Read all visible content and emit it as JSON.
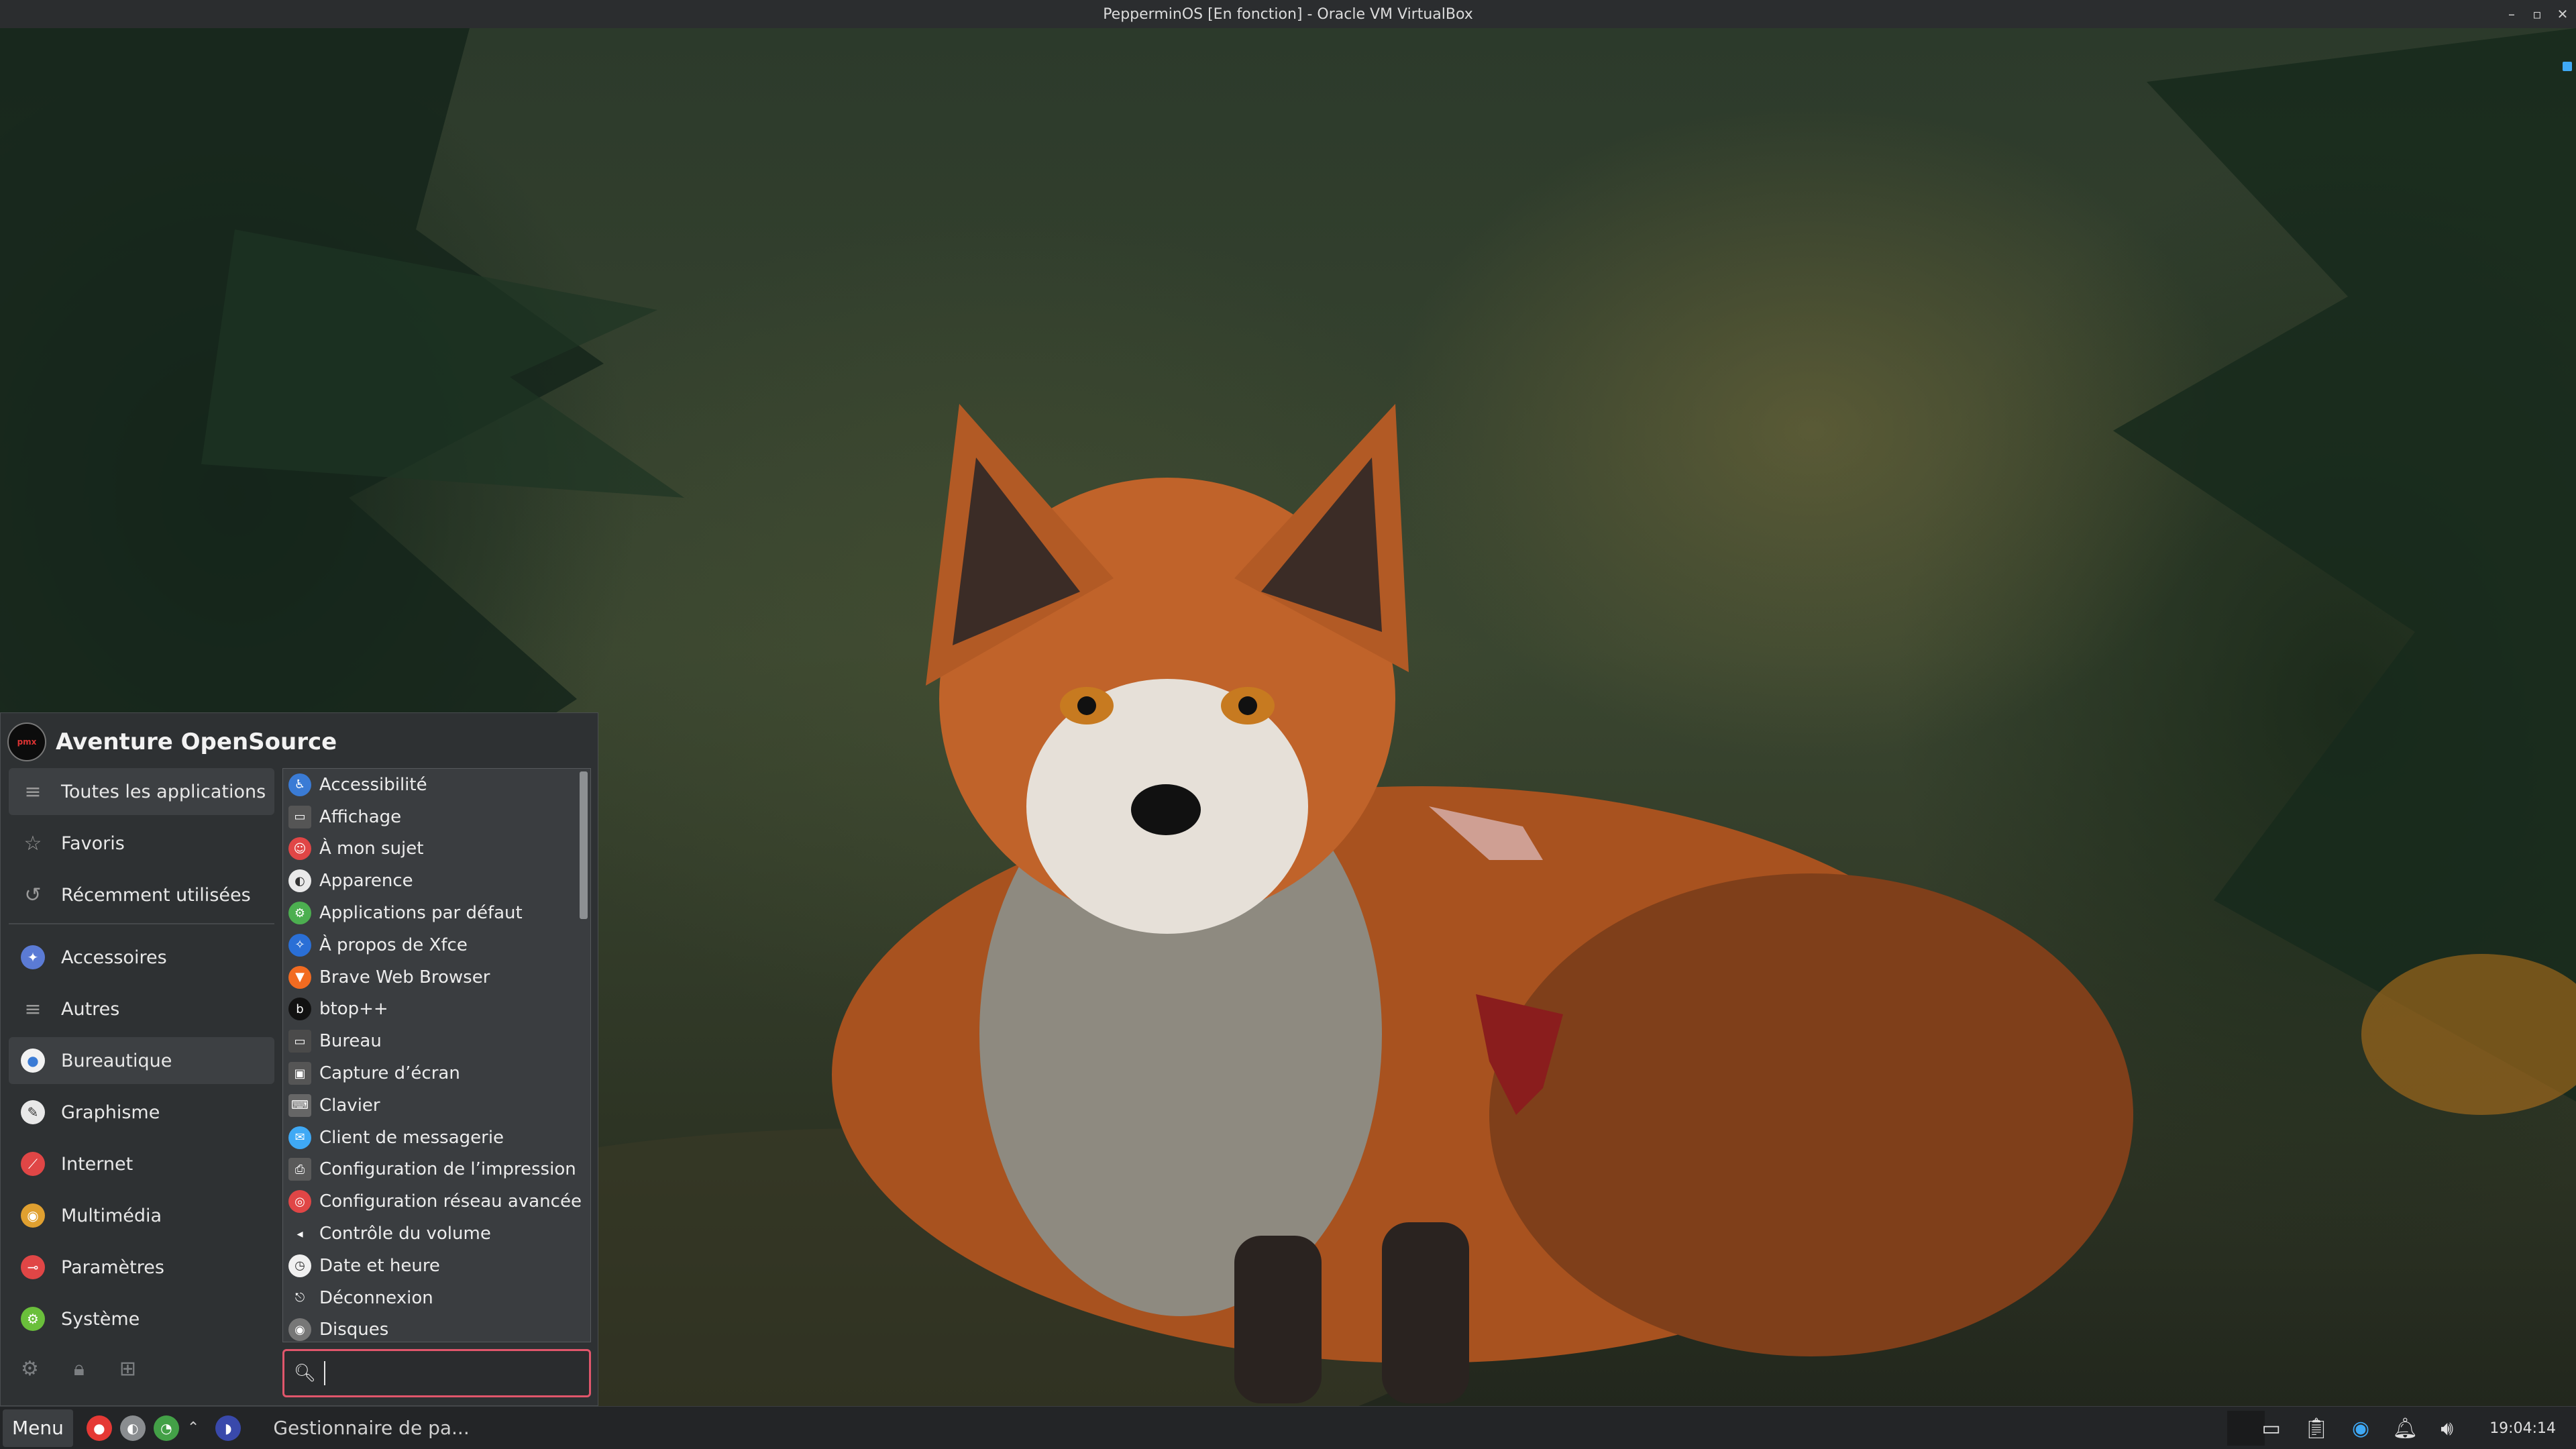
{
  "window": {
    "title": "PepperminOS [En fonction] - Oracle VM VirtualBox",
    "controls": [
      "–",
      "▫",
      "✕"
    ]
  },
  "menu": {
    "user_name": "Aventure OpenSource",
    "avatar_icon": "user-avatar-icon",
    "categories": [
      {
        "label": "Toutes les applications",
        "icon": "all-apps-icon",
        "selected": true
      },
      {
        "label": "Favoris",
        "icon": "star-icon"
      },
      {
        "label": "Récemment utilisées",
        "icon": "history-icon"
      },
      {
        "label": "Accessoires",
        "icon": "accessories-icon"
      },
      {
        "label": "Autres",
        "icon": "other-icon"
      },
      {
        "label": "Bureautique",
        "icon": "office-icon",
        "hovered": true
      },
      {
        "label": "Graphisme",
        "icon": "graphics-icon"
      },
      {
        "label": "Internet",
        "icon": "internet-icon"
      },
      {
        "label": "Multimédia",
        "icon": "multimedia-icon"
      },
      {
        "label": "Paramètres",
        "icon": "settings-icon"
      },
      {
        "label": "Système",
        "icon": "system-icon"
      }
    ],
    "apps": [
      {
        "label": "Accessibilité",
        "icon": "accessibility-icon",
        "color": "#3a7bd5"
      },
      {
        "label": "Affichage",
        "icon": "display-icon",
        "color": "#555555"
      },
      {
        "label": "À mon sujet",
        "icon": "about-me-icon",
        "color": "#e04646"
      },
      {
        "label": "Apparence",
        "icon": "appearance-icon",
        "color": "#e9e9e9"
      },
      {
        "label": "Applications par défaut",
        "icon": "default-apps-icon",
        "color": "#4caf50"
      },
      {
        "label": "À propos de Xfce",
        "icon": "xfce-icon",
        "color": "#2a6fd6"
      },
      {
        "label": "Brave Web Browser",
        "icon": "brave-icon",
        "color": "#f26b21"
      },
      {
        "label": "btop++",
        "icon": "btop-icon",
        "color": "#111111"
      },
      {
        "label": "Bureau",
        "icon": "desktop-icon",
        "color": "#4a4a4a"
      },
      {
        "label": "Capture d’écran",
        "icon": "screenshot-icon",
        "color": "#555555"
      },
      {
        "label": "Clavier",
        "icon": "keyboard-icon",
        "color": "#666666"
      },
      {
        "label": "Client de messagerie",
        "icon": "mail-client-icon",
        "color": "#3fa9f5"
      },
      {
        "label": "Configuration de l’impression",
        "icon": "printer-icon",
        "color": "#5a5a5a"
      },
      {
        "label": "Configuration réseau avancée",
        "icon": "network-icon",
        "color": "#e04646"
      },
      {
        "label": "Contrôle du volume",
        "icon": "volume-icon",
        "color": "#3a3d40"
      },
      {
        "label": "Date et heure",
        "icon": "clock-icon",
        "color": "#f0f0f0"
      },
      {
        "label": "Déconnexion",
        "icon": "logout-icon",
        "color": "#3a3d40"
      },
      {
        "label": "Disques",
        "icon": "disks-icon",
        "color": "#777777"
      }
    ],
    "search": {
      "value": "",
      "placeholder": ""
    },
    "footer_icons": [
      "settings-gear-icon",
      "lock-icon",
      "switch-user-icon"
    ]
  },
  "taskbar": {
    "menu_label": "Menu",
    "launchers": [
      {
        "icon": "app-launcher-red-icon",
        "color": "#e53935"
      },
      {
        "icon": "app-launcher-grey-icon",
        "color": "#8a8d90"
      },
      {
        "icon": "app-launcher-green-icon",
        "color": "#43a047"
      },
      {
        "icon": "chevron-up-icon",
        "color": "#cccccc"
      },
      {
        "icon": "app-launcher-blue-icon",
        "color": "#3949ab"
      }
    ],
    "task_label": "Gestionnaire de pa...",
    "tray_icons": [
      "display-icon",
      "clipboard-icon",
      "network-icon",
      "notification-bell-icon",
      "volume-icon"
    ],
    "clock": "19:04:14"
  },
  "colors": {
    "accent": "#e0566b",
    "panel_bg": "#2e3133"
  }
}
